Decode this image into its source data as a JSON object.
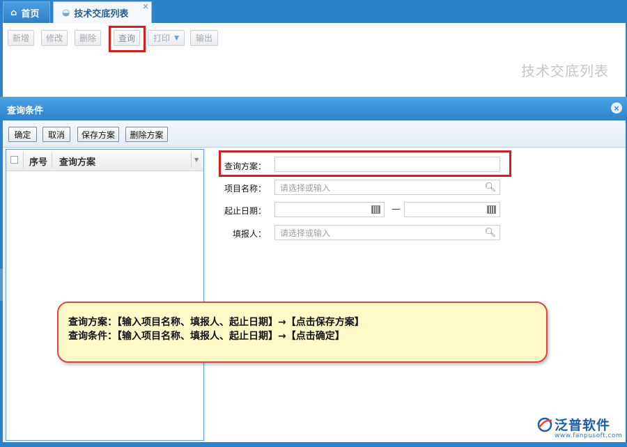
{
  "tabs": [
    {
      "label": "首页",
      "icon": "home-icon"
    },
    {
      "label": "技术交底列表",
      "icon": "page-icon",
      "close": "×"
    }
  ],
  "toolbar": {
    "new": "新增",
    "edit": "修改",
    "delete": "删除",
    "query": "查询",
    "print": "打印",
    "export": "输出"
  },
  "page_watermark": "技术交底列表",
  "dialog": {
    "title": "查询条件",
    "close": "×",
    "buttons": {
      "confirm": "确定",
      "cancel": "取消",
      "save_plan": "保存方案",
      "delete_plan": "删除方案"
    },
    "list": {
      "columns": [
        "序号",
        "查询方案"
      ]
    },
    "form": {
      "plan_label": "查询方案：",
      "plan_value": "",
      "project_label": "项目名称：",
      "project_placeholder": "请选择或输入",
      "date_label": "起止日期：",
      "date_start": "",
      "date_sep": "—",
      "date_end": "",
      "reporter_label": "填报人：",
      "reporter_placeholder": "请选择或输入"
    }
  },
  "callout": {
    "line1": "查询方案：【输入项目名称、填报人、起止日期】→【点击保存方案】",
    "line2": "查询条件：【输入项目名称、填报人、起止日期】→【点击确定】"
  },
  "brand": {
    "name": "泛普软件",
    "url": "www.fanpusoft.com"
  },
  "colors": {
    "header_blue": "#2e82c9",
    "highlight_red": "#d71d1d",
    "callout_bg": "#fef9c7"
  }
}
